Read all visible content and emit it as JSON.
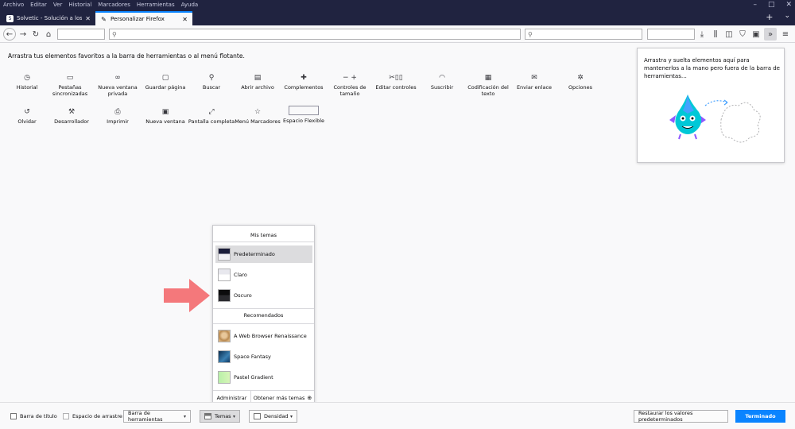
{
  "menubar": [
    "Archivo",
    "Editar",
    "Ver",
    "Historial",
    "Marcadores",
    "Herramientas",
    "Ayuda"
  ],
  "tabs": [
    {
      "label": "Solvetic - Solución a los proble"
    },
    {
      "label": "Personalizar Firefox"
    }
  ],
  "intro": "Arrastra tus elementos favoritos a la barra de herramientas o al menú flotante.",
  "palette": [
    {
      "label": "Historial",
      "icon": "clock-icon",
      "glyph": "◷"
    },
    {
      "label": "Pestañas sincronizadas",
      "icon": "synced-tabs-icon",
      "glyph": "▭"
    },
    {
      "label": "Nueva ventana privada",
      "icon": "private-mask-icon",
      "glyph": "∞"
    },
    {
      "label": "Guardar página",
      "icon": "folder-icon",
      "glyph": "▢"
    },
    {
      "label": "Buscar",
      "icon": "search-icon",
      "glyph": "⚲"
    },
    {
      "label": "Abrir archivo",
      "icon": "open-file-icon",
      "glyph": "▤"
    },
    {
      "label": "Complementos",
      "icon": "puzzle-icon",
      "glyph": "✚"
    },
    {
      "label": "Controles de tamaño",
      "icon": "zoom-icon",
      "glyph": "− +"
    },
    {
      "label": "Editar controles",
      "icon": "edit-controls-icon",
      "glyph": "✂▯▯"
    },
    {
      "label": "Suscribir",
      "icon": "rss-icon",
      "glyph": "◠"
    },
    {
      "label": "Codificación del texto",
      "icon": "text-encoding-icon",
      "glyph": "▦"
    },
    {
      "label": "Enviar enlace",
      "icon": "email-icon",
      "glyph": "✉"
    },
    {
      "label": "Opciones",
      "icon": "gear-icon",
      "glyph": "✲"
    },
    {
      "label": "Olvidar",
      "icon": "forget-icon",
      "glyph": "↺"
    },
    {
      "label": "Desarrollador",
      "icon": "wrench-icon",
      "glyph": "⚒"
    },
    {
      "label": "Imprimir",
      "icon": "printer-icon",
      "glyph": "⎙"
    },
    {
      "label": "Nueva ventana",
      "icon": "new-window-icon",
      "glyph": "▣"
    },
    {
      "label": "Pantalla completa",
      "icon": "fullscreen-icon",
      "glyph": "⤢"
    },
    {
      "label": "Menú Marcadores",
      "icon": "bookmarks-menu-icon",
      "glyph": "☆"
    },
    {
      "label": "Espacio Flexible",
      "icon": "",
      "glyph": ""
    }
  ],
  "overflow": {
    "message": "Arrastra y suelta elementos aquí para mantenerlos a la mano pero fuera de la barra de herramientas…"
  },
  "themes": {
    "my_themes_header": "Mis temas",
    "my_themes": [
      {
        "name": "Predeterminado",
        "selected": true,
        "swatch": "sw-default"
      },
      {
        "name": "Claro",
        "selected": false,
        "swatch": "sw-light"
      },
      {
        "name": "Oscuro",
        "selected": false,
        "swatch": "sw-dark"
      }
    ],
    "recommended_header": "Recomendados",
    "recommended": [
      {
        "name": "A Web Browser Renaissance",
        "swatch": "sw-ren"
      },
      {
        "name": "Space Fantasy",
        "swatch": "sw-space"
      },
      {
        "name": "Pastel Gradient",
        "swatch": "sw-pastel"
      }
    ],
    "manage": "Administrar",
    "get_more": "Obtener más temas"
  },
  "bottom": {
    "title_bar": "Barra de título",
    "drag_space": "Espacio de arrastre",
    "toolbars": "Barra de herramientas",
    "themes": "Temas",
    "density": "Densidad",
    "restore": "Restaurar los valores predeterminados",
    "done": "Terminado"
  },
  "colors": {
    "accent": "#0a84ff",
    "chrome_dark": "#202340",
    "arrow": "#f4787b"
  }
}
